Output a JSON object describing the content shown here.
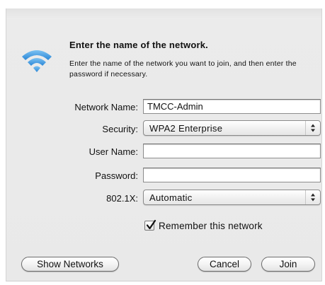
{
  "dialog": {
    "heading": "Enter the name of the network.",
    "description": "Enter the name of the network you want to join, and then enter the password if necessary."
  },
  "form": {
    "network_name": {
      "label": "Network Name:",
      "value": "TMCC-Admin"
    },
    "security": {
      "label": "Security:",
      "value": "WPA2 Enterprise"
    },
    "user_name": {
      "label": "User Name:",
      "value": ""
    },
    "password": {
      "label": "Password:",
      "value": ""
    },
    "dot1x": {
      "label": "802.1X:",
      "value": "Automatic"
    },
    "remember": {
      "label": "Remember this network",
      "checked": true
    }
  },
  "buttons": {
    "show_networks": "Show Networks",
    "cancel": "Cancel",
    "join": "Join"
  },
  "icons": {
    "wifi": "wifi-icon",
    "popup_arrows": "up-down-arrows-icon",
    "check": "checkmark-icon"
  },
  "colors": {
    "wifi_blue": "#4a9ee0",
    "background": "#ebebeb"
  }
}
